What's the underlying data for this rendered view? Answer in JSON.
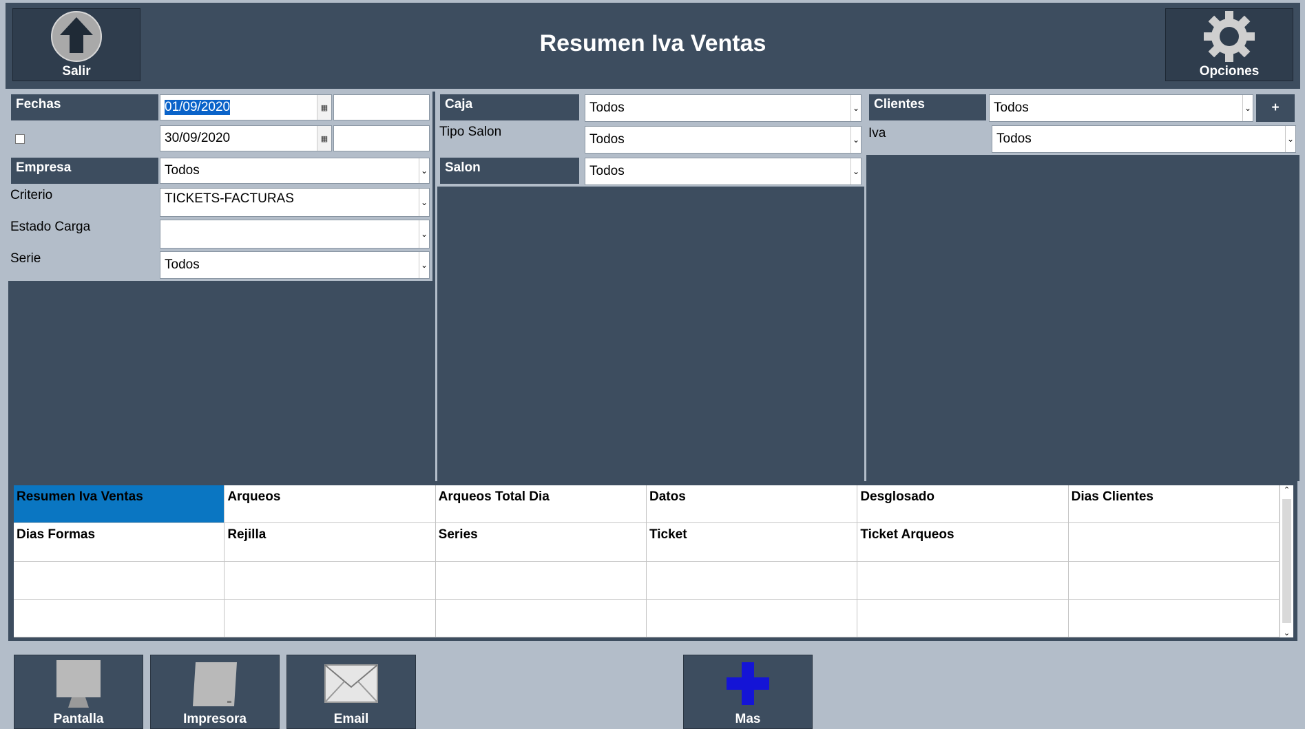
{
  "header": {
    "title": "Resumen Iva Ventas",
    "exit_label": "Salir",
    "options_label": "Opciones"
  },
  "panel1": {
    "fechas_label": "Fechas",
    "date_from": "01/09/2020",
    "date_to": "30/09/2020",
    "empresa_label": "Empresa",
    "empresa_value": "Todos",
    "criterio_label": "Criterio",
    "criterio_value": "TICKETS-FACTURAS",
    "estado_label": "Estado Carga",
    "estado_value": "",
    "serie_label": "Serie",
    "serie_value": "Todos"
  },
  "panel2": {
    "caja_label": "Caja",
    "caja_value": "Todos",
    "tipo_salon_label": "Tipo Salon",
    "tipo_salon_value": "Todos",
    "salon_label": "Salon",
    "salon_value": "Todos"
  },
  "panel3": {
    "clientes_label": "Clientes",
    "clientes_value": "Todos",
    "add_label": "+",
    "iva_label": "Iva",
    "iva_value": "Todos"
  },
  "reports": [
    [
      "Resumen Iva Ventas",
      "Arqueos",
      "Arqueos Total Dia",
      "Datos",
      "Desglosado",
      "Dias Clientes"
    ],
    [
      "Dias Formas",
      "Rejilla",
      "Series",
      "Ticket",
      "Ticket Arqueos",
      ""
    ],
    [
      "",
      "",
      "",
      "",
      "",
      ""
    ],
    [
      "",
      "",
      "",
      "",
      "",
      ""
    ]
  ],
  "bottom": {
    "pantalla": "Pantalla",
    "impresora": "Impresora",
    "email": "Email",
    "mas": "Mas"
  },
  "colors": {
    "panel": "#3d4d5f",
    "background": "#b3bdc9",
    "selected": "#0a76c2"
  }
}
